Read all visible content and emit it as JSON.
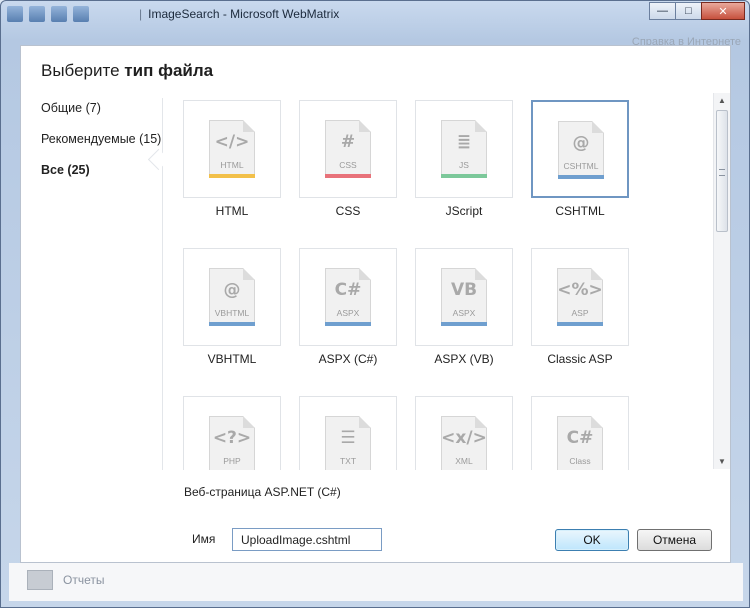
{
  "window": {
    "title": "ImageSearch - Microsoft WebMatrix",
    "buttons": {
      "minimize": "▭",
      "maximize": "□",
      "close": "✕"
    }
  },
  "background": {
    "help_link": "Справка в Интернете",
    "reports_label": "Отчеты"
  },
  "dialog": {
    "title_prefix": "Выберите",
    "title_bold": "тип файла",
    "categories": [
      {
        "label": "Общие (7)",
        "active": false
      },
      {
        "label": "Рекомендуемые (15)",
        "active": false
      },
      {
        "label": "Все (25)",
        "active": true
      }
    ],
    "file_types": [
      {
        "label": "HTML",
        "glyph": "</>",
        "ext": "HTML",
        "stripe": "#f2c04a",
        "selected": false
      },
      {
        "label": "CSS",
        "glyph": "#",
        "ext": "CSS",
        "stripe": "#e8727a",
        "selected": false
      },
      {
        "label": "JScript",
        "glyph": "≣",
        "ext": "JS",
        "stripe": "#7cc89a",
        "selected": false
      },
      {
        "label": "CSHTML",
        "glyph": "@",
        "ext": "CSHTML",
        "stripe": "#6f9fcf",
        "selected": true
      },
      {
        "label": "VBHTML",
        "glyph": "@",
        "ext": "VBHTML",
        "stripe": "#6f9fcf",
        "selected": false
      },
      {
        "label": "ASPX (C#)",
        "glyph": "C#",
        "ext": "ASPX",
        "stripe": "#6f9fcf",
        "selected": false
      },
      {
        "label": "ASPX (VB)",
        "glyph": "VB",
        "ext": "ASPX",
        "stripe": "#6f9fcf",
        "selected": false
      },
      {
        "label": "Classic ASP",
        "glyph": "<%>",
        "ext": "ASP",
        "stripe": "#6f9fcf",
        "selected": false
      },
      {
        "label": "",
        "glyph": "<?>",
        "ext": "PHP",
        "stripe": "#6f9fcf",
        "selected": false
      },
      {
        "label": "",
        "glyph": "☰",
        "ext": "TXT",
        "stripe": "#6f9fcf",
        "selected": false
      },
      {
        "label": "",
        "glyph": "<x/>",
        "ext": "XML",
        "stripe": "#6f9fcf",
        "selected": false
      },
      {
        "label": "",
        "glyph": "C#",
        "ext": "Class",
        "stripe": "#6f9fcf",
        "selected": false
      }
    ],
    "description": "Веб-страница ASP.NET (C#)",
    "name_label": "Имя",
    "name_value": "UploadImage.cshtml",
    "ok_label": "OK",
    "cancel_label": "Отмена"
  }
}
